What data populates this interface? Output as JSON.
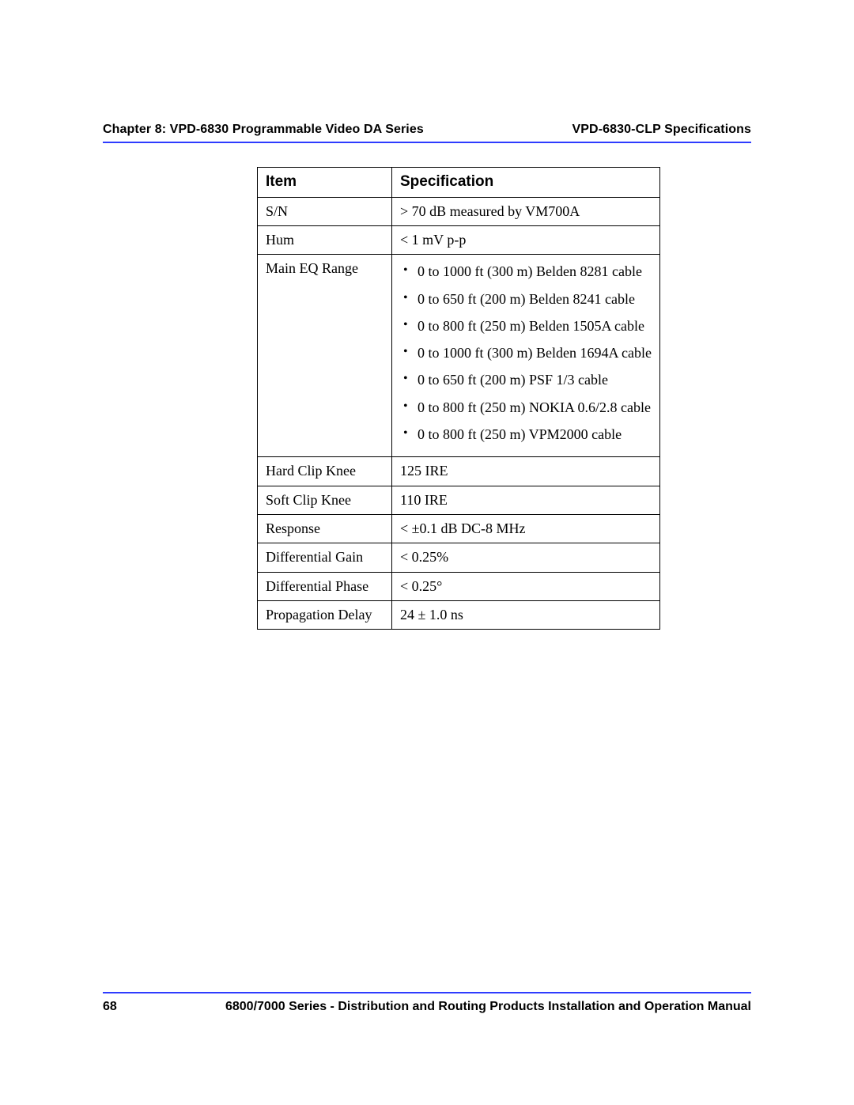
{
  "header": {
    "left": "Chapter 8: VPD-6830 Programmable Video DA Series",
    "right": "VPD-6830-CLP Specifications"
  },
  "table": {
    "head": {
      "item": "Item",
      "spec": "Specification"
    },
    "rows": [
      {
        "item": "S/N",
        "spec": "> 70 dB measured by VM700A"
      },
      {
        "item": "Hum",
        "spec": "< 1 mV p-p"
      },
      {
        "item": "Main EQ Range",
        "spec_list": [
          "0 to 1000 ft (300 m) Belden 8281 cable",
          "0 to 650 ft (200 m) Belden 8241 cable",
          "0 to 800 ft (250 m) Belden 1505A cable",
          "0 to 1000 ft (300 m) Belden 1694A cable",
          "0 to 650 ft (200 m) PSF 1/3 cable",
          "0 to 800 ft (250 m) NOKIA 0.6/2.8 cable",
          "0 to 800 ft (250 m) VPM2000 cable"
        ]
      },
      {
        "item": "Hard Clip Knee",
        "spec": "125 IRE"
      },
      {
        "item": "Soft Clip Knee",
        "spec": "110 IRE"
      },
      {
        "item": "Response",
        "spec": "< ±0.1 dB DC-8 MHz"
      },
      {
        "item": "Differential Gain",
        "spec": "< 0.25%"
      },
      {
        "item": "Differential Phase",
        "spec": "< 0.25°"
      },
      {
        "item": "Propagation Delay",
        "spec": "24 ± 1.0 ns"
      }
    ]
  },
  "footer": {
    "page": "68",
    "title": "6800/7000 Series - Distribution and Routing Products Installation and Operation Manual"
  }
}
